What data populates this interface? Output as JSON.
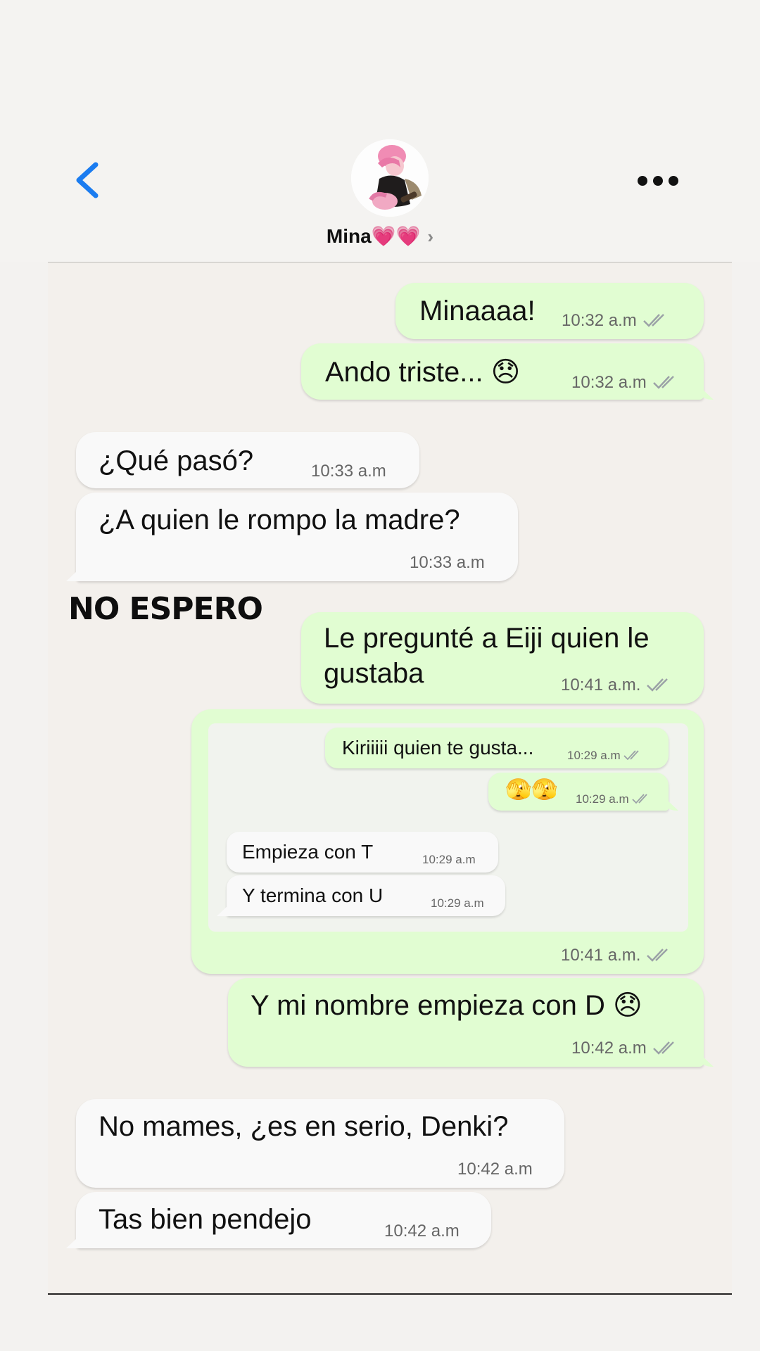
{
  "header": {
    "contact_name": "Mina💗💗",
    "back_icon": "chevron-left-icon",
    "more_icon": "more-dots-icon",
    "accent": "#1b7cf0"
  },
  "messages": [
    {
      "id": "m1",
      "dir": "out",
      "text": "Minaaaa!",
      "time": "10:32 a.m"
    },
    {
      "id": "m2",
      "dir": "out",
      "text": "Ando triste... 😞",
      "time": "10:32 a.m"
    },
    {
      "id": "m3",
      "dir": "in",
      "text": "¿Qué pasó?",
      "time": "10:33 a.m"
    },
    {
      "id": "m4",
      "dir": "in",
      "text": "¿A quien le rompo la madre?",
      "time": "10:33 a.m"
    },
    {
      "id": "m5",
      "dir": "out",
      "text_line1": "Le pregunté a Eiji quien le",
      "text_line2": "gustaba",
      "time": "10:41 a.m."
    },
    {
      "id": "m6",
      "dir": "out",
      "type": "image",
      "time": "10:41 a.m."
    },
    {
      "id": "m7",
      "dir": "out",
      "text": "Y mi nombre empieza con D 😞",
      "time": "10:42 a.m"
    },
    {
      "id": "m8",
      "dir": "in",
      "text": "No mames, ¿es en serio, Denki?",
      "time": "10:42 a.m"
    },
    {
      "id": "m9",
      "dir": "in",
      "text": "Tas bien pendejo",
      "time": "10:42 a.m"
    }
  ],
  "annotation": "NO ESPERO",
  "embedded_screenshot": {
    "messages": [
      {
        "dir": "out",
        "text": "Kiriiiii quien te gusta...",
        "time": "10:29 a.m"
      },
      {
        "dir": "out",
        "text": "🫣🫣",
        "time": "10:29 a.m"
      },
      {
        "dir": "in",
        "text": "Empieza con T",
        "time": "10:29 a.m"
      },
      {
        "dir": "in",
        "text": "Y termina con U",
        "time": "10:29 a.m"
      }
    ]
  },
  "colors": {
    "outgoing_bubble": "#e1fdd2",
    "incoming_bubble": "#f9f9f9",
    "chat_background": "#f3f0ec",
    "tick_color": "#9aa0a6"
  }
}
